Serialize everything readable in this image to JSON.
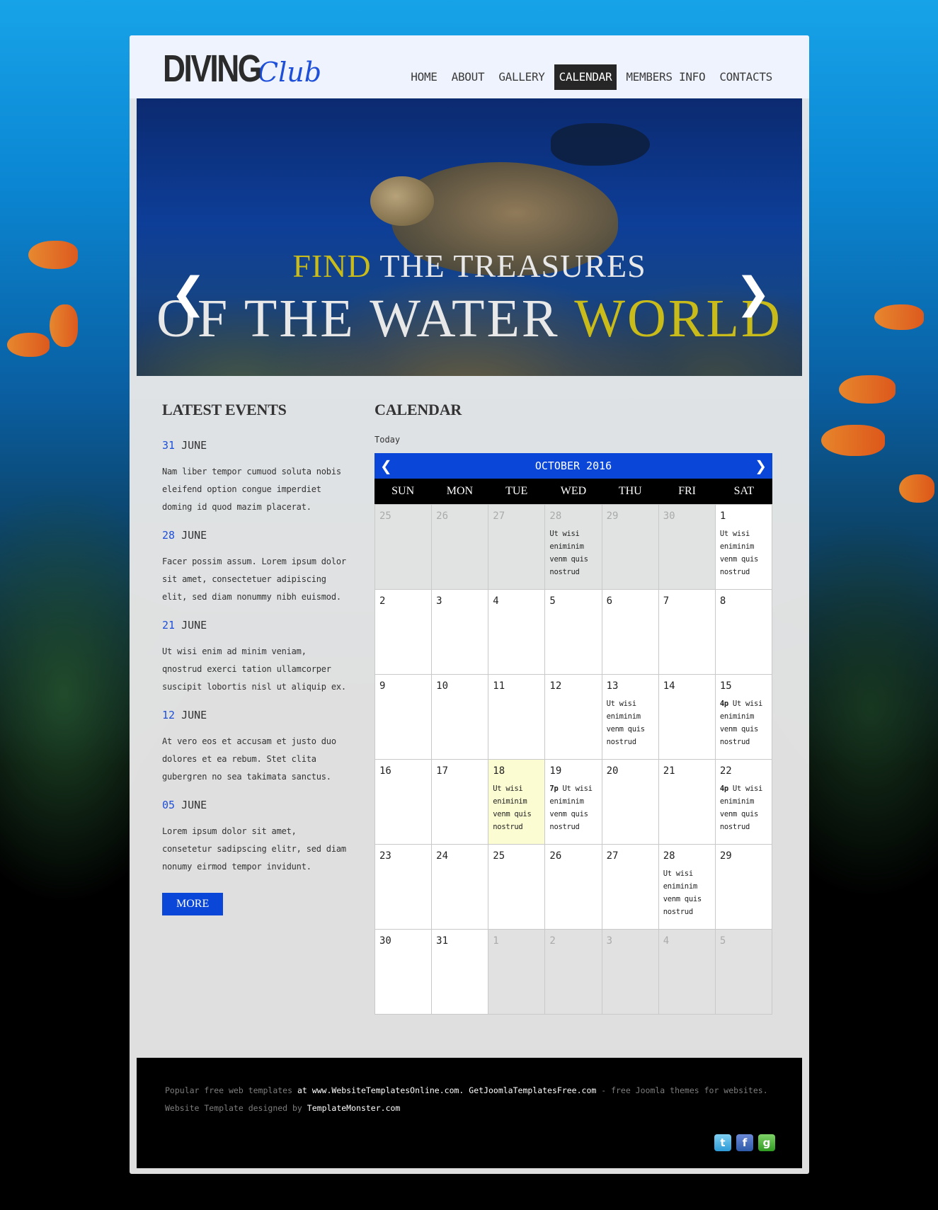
{
  "logo": {
    "main": "DIVING",
    "script": "Club"
  },
  "nav": [
    {
      "label": "HOME",
      "active": false
    },
    {
      "label": "ABOUT",
      "active": false
    },
    {
      "label": "GALLERY",
      "active": false
    },
    {
      "label": "CALENDAR",
      "active": true
    },
    {
      "label": "MEMBERS INFO",
      "active": false
    },
    {
      "label": "CONTACTS",
      "active": false
    }
  ],
  "banner": {
    "line1_a": "FIND",
    "line1_b": " THE TREASURES",
    "line2_a": "OF THE WATER ",
    "line2_b": "WORLD",
    "prev_icon": "❮",
    "next_icon": "❯"
  },
  "events": {
    "heading": "LATEST EVENTS",
    "items": [
      {
        "day": "31",
        "month": "JUNE",
        "text": "Nam liber tempor cumuod soluta nobis eleifend option congue imperdiet doming id quod mazim placerat."
      },
      {
        "day": "28",
        "month": "JUNE",
        "text": "Facer possim assum. Lorem ipsum dolor sit amet, consectetuer adipiscing elit, sed diam nonummy nibh euismod."
      },
      {
        "day": "21",
        "month": "JUNE",
        "text": "Ut wisi enim ad minim veniam, qnostrud exerci tation ullamcorper suscipit lobortis nisl ut aliquip ex."
      },
      {
        "day": "12",
        "month": "JUNE",
        "text": "At vero eos et accusam et justo duo dolores et ea rebum. Stet clita gubergren no sea takimata sanctus."
      },
      {
        "day": "05",
        "month": "JUNE",
        "text": "Lorem ipsum dolor sit amet, consetetur sadipscing elitr, sed diam nonumy eirmod tempor invidunt."
      }
    ],
    "more_label": "MORE"
  },
  "calendar": {
    "heading": "CALENDAR",
    "today_label": "Today",
    "month_title": "OCTOBER 2016",
    "prev_icon": "❮",
    "next_icon": "❯",
    "weekdays": [
      "SUN",
      "MON",
      "TUE",
      "WED",
      "THU",
      "FRI",
      "SAT"
    ],
    "event_text": "Ut wisi eniminim venm quis nostrud",
    "days": [
      {
        "num": "25",
        "other": true
      },
      {
        "num": "26",
        "other": true
      },
      {
        "num": "27",
        "other": true
      },
      {
        "num": "28",
        "other": true,
        "event": true
      },
      {
        "num": "29",
        "other": true
      },
      {
        "num": "30",
        "other": true
      },
      {
        "num": "1",
        "event": true
      },
      {
        "num": "2"
      },
      {
        "num": "3"
      },
      {
        "num": "4"
      },
      {
        "num": "5"
      },
      {
        "num": "6"
      },
      {
        "num": "7"
      },
      {
        "num": "8"
      },
      {
        "num": "9"
      },
      {
        "num": "10"
      },
      {
        "num": "11"
      },
      {
        "num": "12"
      },
      {
        "num": "13",
        "event": true
      },
      {
        "num": "14"
      },
      {
        "num": "15",
        "event": true,
        "time": "4p"
      },
      {
        "num": "16"
      },
      {
        "num": "17"
      },
      {
        "num": "18",
        "today": true,
        "event": true
      },
      {
        "num": "19",
        "event": true,
        "time": "7p"
      },
      {
        "num": "20"
      },
      {
        "num": "21"
      },
      {
        "num": "22",
        "event": true,
        "time": "4p"
      },
      {
        "num": "23"
      },
      {
        "num": "24"
      },
      {
        "num": "25"
      },
      {
        "num": "26"
      },
      {
        "num": "27"
      },
      {
        "num": "28",
        "event": true
      },
      {
        "num": "29"
      },
      {
        "num": "30"
      },
      {
        "num": "31"
      },
      {
        "num": "1",
        "other": true
      },
      {
        "num": "2",
        "other": true
      },
      {
        "num": "3",
        "other": true
      },
      {
        "num": "4",
        "other": true
      },
      {
        "num": "5",
        "other": true
      }
    ]
  },
  "footer": {
    "line1_a": "Popular free web templates",
    "line1_b": " at www.WebsiteTemplatesOnline.com",
    "line1_c": ". ",
    "line1_d": "GetJoomlaTemplatesFree.com",
    "line1_e": " - free Joomla themes for websites.",
    "line2_a": "Website Template designed by ",
    "line2_b": "TemplateMonster.com",
    "social_icons": [
      "twitter-icon",
      "facebook-icon",
      "gowalla-icon"
    ]
  }
}
